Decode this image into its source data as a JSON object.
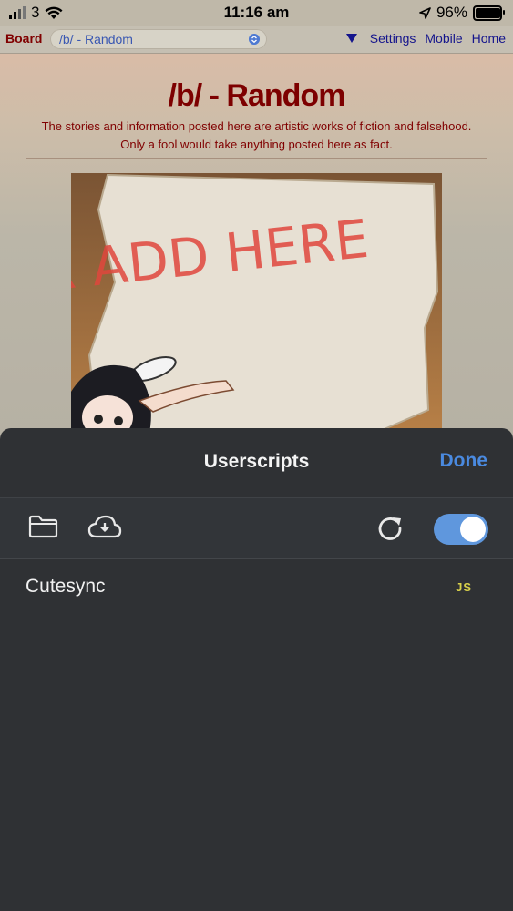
{
  "status": {
    "carrier": "3",
    "time": "11:16 am",
    "battery": "96%",
    "battery_level": 0.96
  },
  "boardnav": {
    "label": "Board",
    "selected": "/b/ - Random",
    "links": [
      "Settings",
      "Mobile",
      "Home"
    ]
  },
  "page": {
    "title": "/b/ - Random",
    "subtitle_line1": "The stories and information posted here are artistic works of fiction and falsehood.",
    "subtitle_line2": "Only a fool would take anything posted here as fact.",
    "banner_text": "UR ADD HERE"
  },
  "sheet": {
    "title": "Userscripts",
    "done_label": "Done",
    "toggle_on": true,
    "scripts": [
      {
        "name": "Cutesync",
        "type": "JS"
      }
    ]
  },
  "colors": {
    "accent": "#4a8ae0",
    "sheet_bg": "#2f3134",
    "board_red": "#7d0000",
    "js_badge": "#d8d04a"
  }
}
